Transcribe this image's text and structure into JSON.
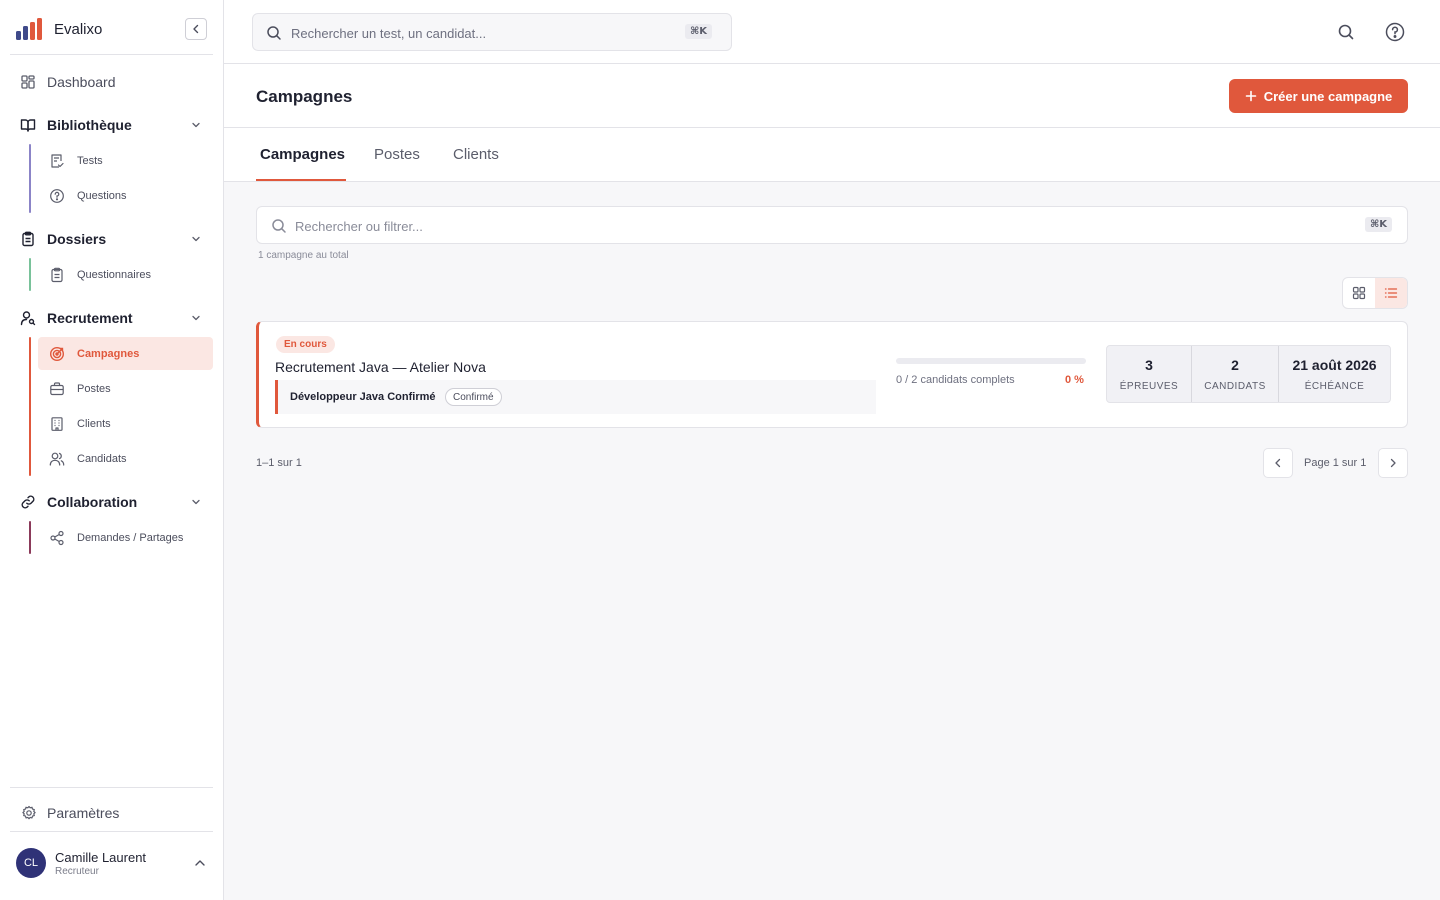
{
  "app": {
    "name": "Evalixo",
    "accent": "#e0583c",
    "avatar_color": "#2f3277"
  },
  "sidebar": {
    "dashboard": "Dashboard",
    "sections": {
      "bibliotheque": {
        "label": "Bibliothèque",
        "items": {
          "tests": "Tests",
          "questions": "Questions"
        }
      },
      "dossiers": {
        "label": "Dossiers",
        "items": {
          "questionnaires": "Questionnaires"
        }
      },
      "recrutement": {
        "label": "Recrutement",
        "items": {
          "campagnes": "Campagnes",
          "postes": "Postes",
          "clients": "Clients",
          "candidats": "Candidats"
        },
        "active": "campagnes"
      },
      "collaboration": {
        "label": "Collaboration",
        "items": {
          "demandes": "Demandes / Partages"
        }
      }
    },
    "settings": "Paramètres",
    "user": {
      "initials": "CL",
      "name": "Camille Laurent",
      "role": "Recruteur"
    }
  },
  "topbar": {
    "search_placeholder": "Rechercher un test, un candidat...",
    "shortcut": "⌘K"
  },
  "page": {
    "title": "Campagnes",
    "create_button": "Créer une campagne"
  },
  "tabs": {
    "campagnes": "Campagnes",
    "postes": "Postes",
    "clients": "Clients",
    "active": "campagnes"
  },
  "filter": {
    "placeholder": "Rechercher ou filtrer...",
    "shortcut": "⌘K",
    "count_text": "1 campagne au total"
  },
  "view_mode": "list",
  "campaign": {
    "status": "En cours",
    "title": "Recrutement Java — Atelier Nova",
    "job_title": "Développeur Java Confirmé",
    "job_level": "Confirmé",
    "progress_fraction": 0,
    "progress_text": "0 / 2 candidats complets",
    "progress_percent": "0 %",
    "stats": {
      "epreuves": {
        "value": "3",
        "label": "ÉPREUVES"
      },
      "candidats": {
        "value": "2",
        "label": "CANDIDATS"
      },
      "echeance": {
        "value": "21 août 2026",
        "label": "ÉCHÉANCE"
      }
    }
  },
  "pagination": {
    "range_text": "1–1 sur 1",
    "page_text": "Page 1 sur 1"
  }
}
